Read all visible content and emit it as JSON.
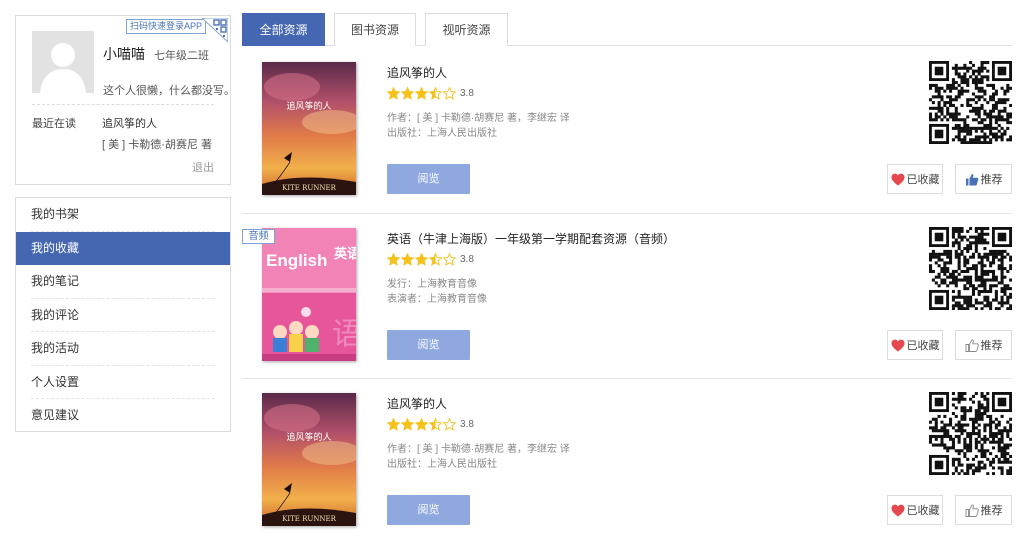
{
  "profile": {
    "qr_login_label": "扫码快速登录APP",
    "name": "小喵喵",
    "class": "七年级二班",
    "signature": "这个人很懒，什么都没写。",
    "recent_label": "最近在读",
    "recent_title": "追风筝的人",
    "recent_author": "[ 美 ] 卡勒德·胡赛尼 著",
    "logout": "退出"
  },
  "menu": [
    {
      "label": "我的书架",
      "active": false
    },
    {
      "label": "我的收藏",
      "active": true
    },
    {
      "label": "我的笔记",
      "active": false
    },
    {
      "label": "我的评论",
      "active": false
    },
    {
      "label": "我的活动",
      "active": false
    },
    {
      "label": "个人设置",
      "active": false
    },
    {
      "label": "意见建议",
      "active": false
    }
  ],
  "tabs": [
    {
      "label": "全部资源",
      "active": true
    },
    {
      "label": "图书资源",
      "active": false
    },
    {
      "label": "视听资源",
      "active": false
    }
  ],
  "colors": {
    "accent": "#4566b1",
    "read_button": "#8fa8df",
    "star": "#f5c11b",
    "heart": "#e5484d",
    "thumb": "#4a72b5"
  },
  "resources": [
    {
      "title": "追风筝的人",
      "rating": 3.5,
      "score": "3.8",
      "meta1": "作者：[ 美 ] 卡勒德·胡赛尼 著，李继宏 译",
      "meta2": "出版社：上海人民出版社",
      "read_label": "阅览",
      "fav_label": "已收藏",
      "rec_label": "推荐",
      "recommended": true,
      "cover": {
        "title": "追风筝的人",
        "en_title": "KITE RUNNER"
      }
    },
    {
      "tag": "音频",
      "title": "英语（牛津上海版）一年级第一学期配套资源（音频）",
      "rating": 3.5,
      "score": "3.8",
      "meta1": "发行：上海教育音像",
      "meta2": "表演者：上海教育音像",
      "read_label": "阅览",
      "fav_label": "已收藏",
      "rec_label": "推荐",
      "recommended": false,
      "cover": {
        "title": "English",
        "cn_title": "英语"
      }
    },
    {
      "title": "追风筝的人",
      "rating": 3.5,
      "score": "3.8",
      "meta1": "作者：[ 美 ] 卡勒德·胡赛尼 著，李继宏 译",
      "meta2": "出版社：上海人民出版社",
      "read_label": "阅览",
      "fav_label": "已收藏",
      "rec_label": "推荐",
      "recommended": false,
      "cover": {
        "title": "追风筝的人",
        "en_title": "KITE RUNNER"
      }
    }
  ]
}
